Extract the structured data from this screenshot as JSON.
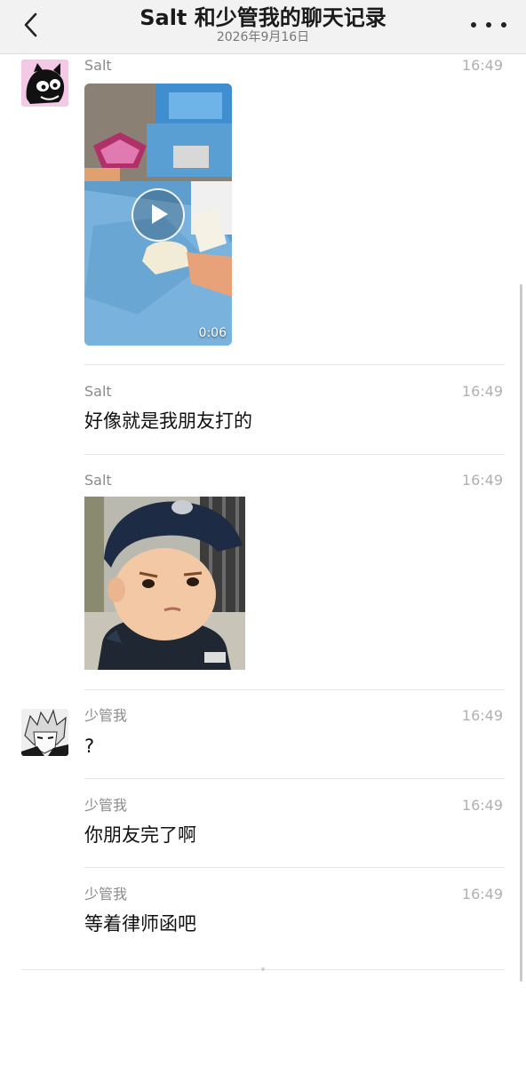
{
  "header": {
    "title": "Salt 和少管我的聊天记录",
    "date": "2026年9月16日"
  },
  "messages": [
    {
      "sender": "Salt",
      "time": "16:49",
      "type": "video",
      "duration": "0:06"
    },
    {
      "sender": "Salt",
      "time": "16:49",
      "type": "text",
      "text": "好像就是我朋友打的"
    },
    {
      "sender": "Salt",
      "time": "16:49",
      "type": "sticker"
    },
    {
      "sender": "少管我",
      "time": "16:49",
      "type": "text",
      "text": "?"
    },
    {
      "sender": "少管我",
      "time": "16:49",
      "type": "text",
      "text": "你朋友完了啊"
    },
    {
      "sender": "少管我",
      "time": "16:49",
      "type": "text",
      "text": "等着律师函吧"
    }
  ],
  "icons": {
    "back": "chevron-left-icon",
    "more": "more-dots-icon",
    "play": "play-icon"
  },
  "colors": {
    "header_bg": "#f2f2f2",
    "sender": "#8a8a8a",
    "time": "#b0b0b0"
  }
}
